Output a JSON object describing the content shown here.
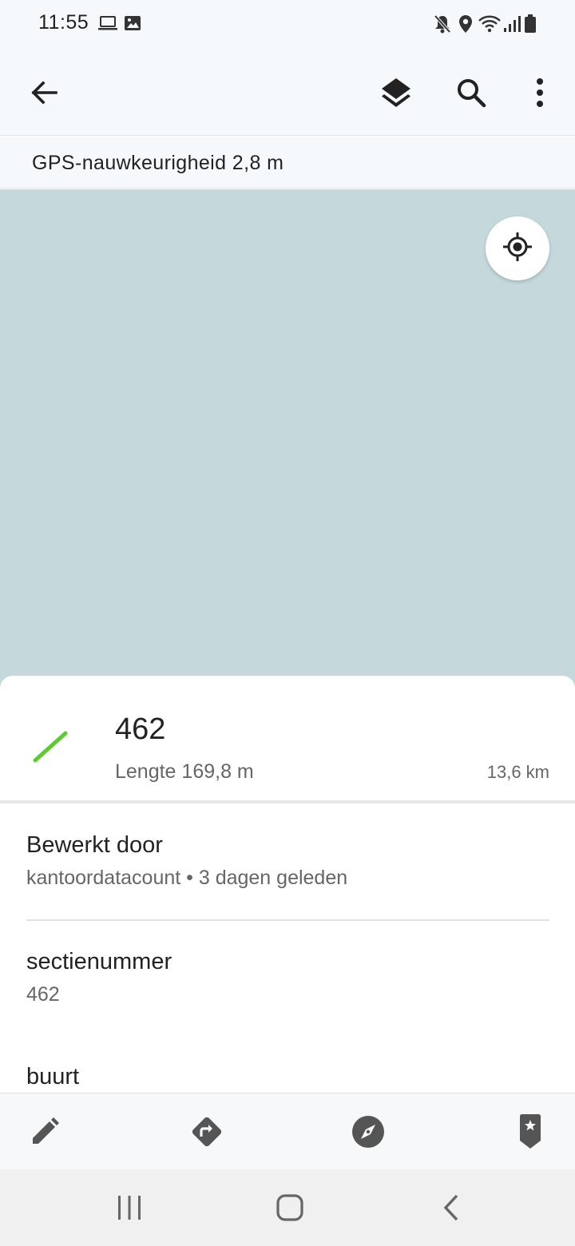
{
  "status_bar": {
    "time": "11:55",
    "icons": [
      "laptop-icon",
      "image-icon",
      "mute-icon",
      "location-icon",
      "wifi-icon",
      "signal-icon",
      "battery-icon"
    ]
  },
  "app_bar": {
    "icons": [
      "back-arrow-icon",
      "layers-icon",
      "search-icon",
      "more-vert-icon"
    ]
  },
  "gps": {
    "text": "GPS-nauwkeurigheid 2,8 m"
  },
  "map": {
    "background": "#c5d9dc",
    "locate_icon": "my-location-icon"
  },
  "feature": {
    "title": "462",
    "subtitle": "Lengte 169,8 m",
    "distance": "13,6 km",
    "line_color": "#5fcc2e"
  },
  "attributes": [
    {
      "label": "Bewerkt door",
      "value": "kantoordatacount • 3 dagen geleden"
    },
    {
      "label": "sectienummer",
      "value": "462"
    },
    {
      "label": "buurt",
      "value": ""
    }
  ],
  "toolbar": {
    "icons": [
      "edit-icon",
      "directions-icon",
      "compass-icon",
      "bookmark-star-icon"
    ]
  },
  "nav_bar": {
    "icons": [
      "recents-icon",
      "home-icon",
      "back-icon"
    ]
  }
}
